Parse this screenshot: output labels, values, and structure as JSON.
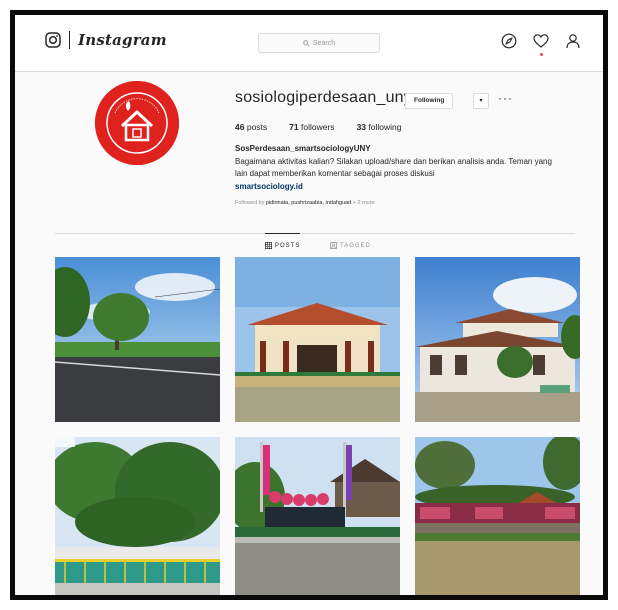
{
  "topbar": {
    "brand_name": "Instagram",
    "search_placeholder": "Search"
  },
  "profile": {
    "username": "sosiologiperdesaan_uny",
    "following_label": "Following",
    "caret_label": "▾",
    "more_label": "···",
    "stats": {
      "posts_count": "46",
      "posts_label": "posts",
      "followers_count": "71",
      "followers_label": "followers",
      "following_count": "33",
      "following_label": "following"
    },
    "bio_name": "SosPerdesaan_smartsociologyUNY",
    "bio_text": "Bagaimana aktivitas kalian? Silakan upload/share dan berikan analisis anda. Teman yang lain dapat memberikan komentar sebagai proses diskusi",
    "bio_link": "smartsociology.id",
    "followed_by_prefix": "Followed by",
    "followed_by_names": "pidinnata, pushrizaabia, indahguad",
    "followed_by_more": "+ 2 more"
  },
  "tabs": {
    "posts_label": "POSTS",
    "tagged_label": "TAGGED"
  },
  "colors": {
    "avatar_red": "#e0221f",
    "link_blue": "#003569",
    "notification_dot": "#ed4956"
  },
  "icons": [
    "instagram-glyph-icon",
    "search-icon",
    "compass-icon",
    "heart-icon",
    "user-icon",
    "grid-icon",
    "tag-icon"
  ]
}
